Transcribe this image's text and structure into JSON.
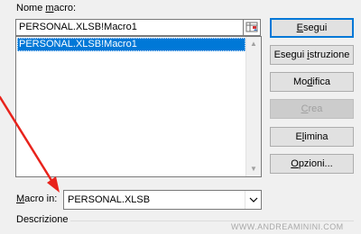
{
  "dialog": {
    "name_label": "Nome macro:",
    "name_label_pre": "Nome ",
    "name_label_u": "m",
    "name_label_post": "acro:",
    "macro_name_value": "PERSONAL.XLSB!Macro1",
    "list_items": [
      "PERSONAL.XLSB!Macro1"
    ],
    "macro_in_label_pre": "",
    "macro_in_label_u": "M",
    "macro_in_label_post": "acro in:",
    "macro_in_value": "PERSONAL.XLSB",
    "description_label": "Descrizione"
  },
  "buttons": {
    "run": {
      "pre": "",
      "u": "E",
      "post": "segui"
    },
    "step": {
      "pre": "Esegui ",
      "u": "i",
      "post": "struzione"
    },
    "edit": {
      "pre": "Mo",
      "u": "d",
      "post": "ifica"
    },
    "create": {
      "pre": "",
      "u": "C",
      "post": "rea"
    },
    "delete": {
      "pre": "E",
      "u": "l",
      "post": "imina"
    },
    "options": {
      "pre": "",
      "u": "O",
      "post": "pzioni..."
    }
  },
  "watermark": "WWW.ANDREAMININI.COM",
  "colors": {
    "selection": "#0078d7",
    "annotation_arrow": "#e8231c",
    "default_button_border": "#0078d7"
  },
  "icons": {
    "ref_button": "collapse-dialog-icon",
    "dropdown": "chevron-down-icon",
    "scroll_up": "triangle-up-icon",
    "scroll_down": "triangle-down-icon"
  }
}
